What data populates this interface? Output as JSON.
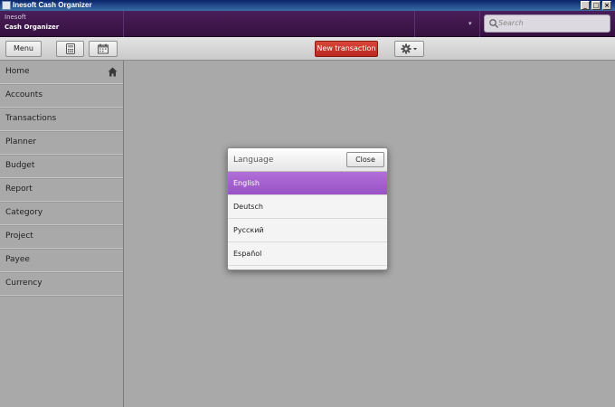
{
  "window": {
    "title": "Inesoft Cash Organizer"
  },
  "header": {
    "company": "Inesoft",
    "product": "Cash Organizer",
    "search_placeholder": "Search"
  },
  "toolbar": {
    "menu_label": "Menu",
    "new_transaction_label": "New transaction"
  },
  "sidebar": {
    "items": [
      {
        "label": "Home"
      },
      {
        "label": "Accounts"
      },
      {
        "label": "Transactions"
      },
      {
        "label": "Planner"
      },
      {
        "label": "Budget"
      },
      {
        "label": "Report"
      },
      {
        "label": "Category"
      },
      {
        "label": "Project"
      },
      {
        "label": "Payee"
      },
      {
        "label": "Currency"
      }
    ]
  },
  "dialog": {
    "title": "Language",
    "close_label": "Close",
    "selected": "English",
    "languages": [
      {
        "label": "English"
      },
      {
        "label": "Deutsch"
      },
      {
        "label": "Русский"
      },
      {
        "label": "Español"
      }
    ]
  },
  "colors": {
    "header": "#3f1a4c",
    "accent_selected": "#a560ce",
    "new_transaction": "#c8352b"
  }
}
